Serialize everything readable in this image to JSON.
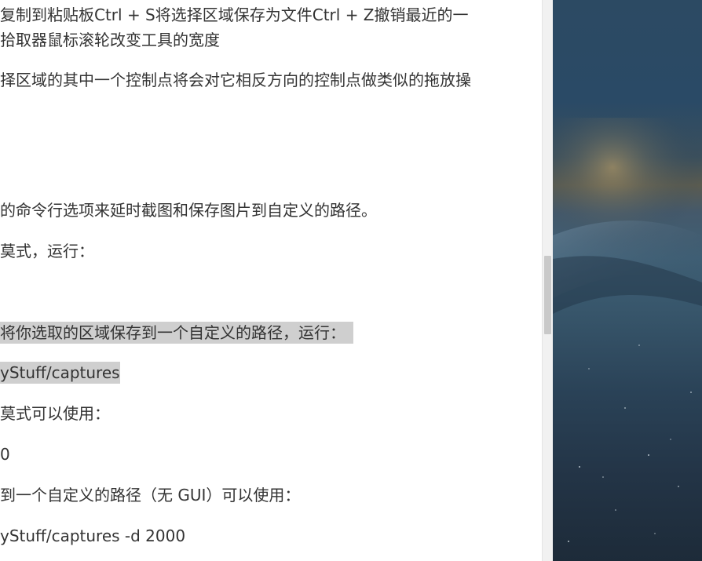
{
  "article": {
    "lines": [
      "复制到粘贴板Ctrl + S将选择区域保存为文件Ctrl + Z撤销最近的一",
      "拾取器鼠标滚轮改变工具的宽度",
      "择区域的其中一个控制点将会对它相反方向的控制点做类似的拖放操",
      "的命令行选项来延时截图和保存图片到自定义的路径。",
      "莫式，运行：",
      "将你选取的区域保存到一个自定义的路径，运行：",
      "yStuff/captures",
      "莫式可以使用：",
      "0",
      "到一个自定义的路径（无 GUI）可以使用：",
      "yStuff/captures -d 2000"
    ]
  },
  "colors": {
    "text": "#333333",
    "highlight": "#cfcfcf",
    "scrollbar_track": "#f1f1f1",
    "scrollbar_thumb": "#c9c9c9"
  },
  "icons": {
    "wallpaper": "galaxy-wallpaper"
  }
}
